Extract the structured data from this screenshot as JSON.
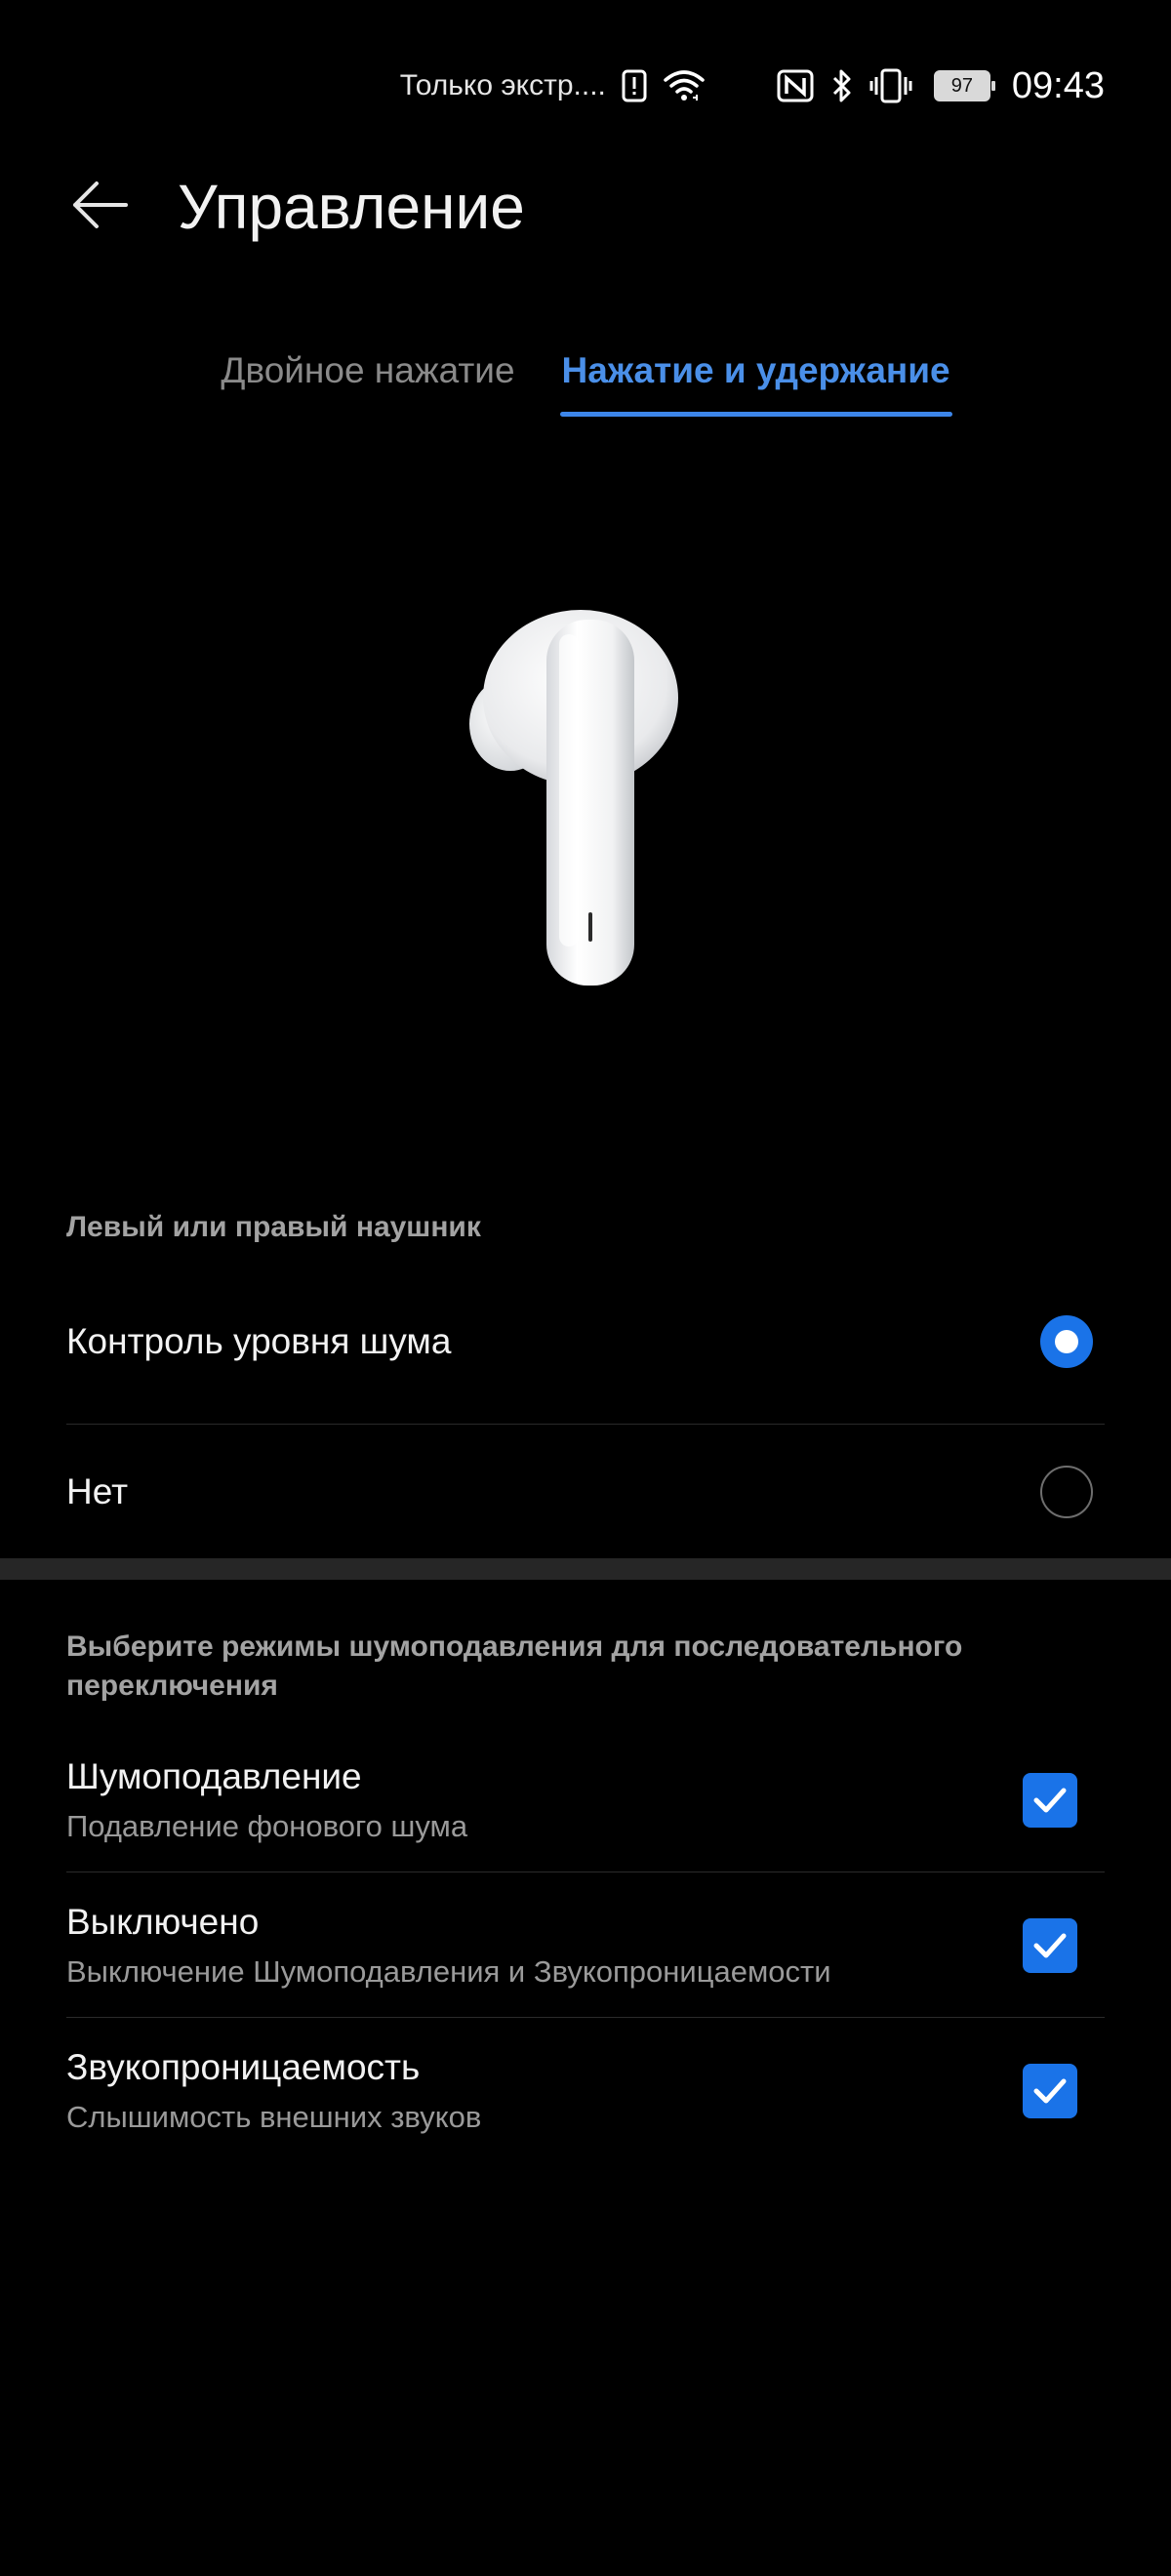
{
  "status_bar": {
    "carrier_text": "Только экстр....",
    "battery_level": "97",
    "time": "09:43",
    "icons": [
      "alert-icon",
      "wifi-icon",
      "nfc-icon",
      "bluetooth-icon",
      "vibrate-icon",
      "battery-icon"
    ]
  },
  "header": {
    "back_icon": "arrow-left-icon",
    "title": "Управление"
  },
  "tabs": [
    {
      "label": "Двойное нажатие",
      "active": false
    },
    {
      "label": "Нажатие и удержание",
      "active": true
    }
  ],
  "illustration": {
    "icon": "earbud-icon"
  },
  "earbud_section": {
    "label": "Левый или правый наушник",
    "options": [
      {
        "label": "Контроль уровня шума",
        "selected": true
      },
      {
        "label": "Нет",
        "selected": false
      }
    ]
  },
  "noise_section": {
    "label": "Выберите режимы шумоподавления для последовательного переключения",
    "items": [
      {
        "title": "Шумоподавление",
        "subtitle": "Подавление фонового шума",
        "checked": true
      },
      {
        "title": "Выключено",
        "subtitle": "Выключение Шумоподавления и Звукопроницаемости",
        "checked": true
      },
      {
        "title": "Звукопроницаемость",
        "subtitle": "Слышимость внешних звуков",
        "checked": true
      }
    ]
  },
  "colors": {
    "accent": "#1a73e8",
    "tab_active": "#4a8fe8",
    "background": "#000000"
  }
}
